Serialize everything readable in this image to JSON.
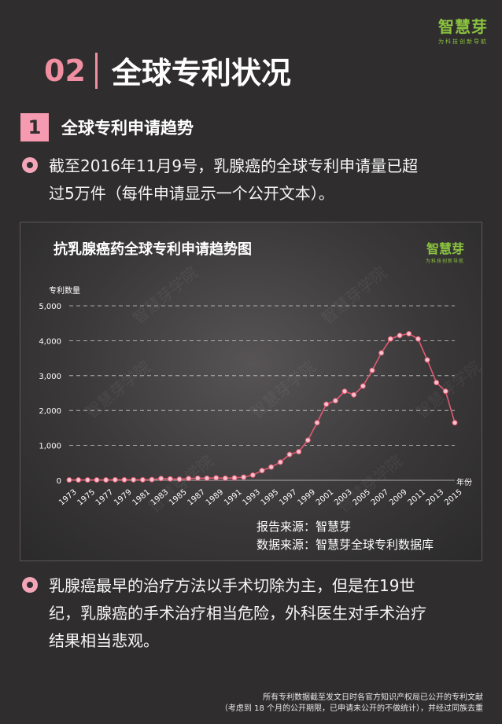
{
  "brand": {
    "name": "智慧芽",
    "sub": "为科技创新导航"
  },
  "section": {
    "num": "02",
    "title": "全球专利状况"
  },
  "sub": {
    "num": "1",
    "title": "全球专利申请趋势"
  },
  "bullet1": {
    "line1": "截至2016年11月9号，乳腺癌的全球专利申请量已超",
    "line2": "过5万件（每件申请显示一个公开文本）。"
  },
  "bullet2": {
    "line1": "乳腺癌最早的治疗方法以手术切除为主，但是在19世",
    "line2": "纪，乳腺癌的手术治疗相当危险，外科医生对手术治疗",
    "line3": "结果相当悲观。"
  },
  "chart_brand": {
    "name": "智慧芽",
    "sub": "为科技创新导航"
  },
  "watermark": "智慧芽学院",
  "sources": {
    "report": "报告来源：智慧芽",
    "data": "数据来源：智慧芽全球专利数据库"
  },
  "footer": {
    "line1": "所有专利数据截至发文日时各官方知识产权局已公开的专利文献",
    "line2": "（考虑到 18 个月的公开期限，已申请未公开的不做统计），并经过同族去重"
  },
  "chart_data": {
    "type": "line",
    "title": "抗乳腺癌药全球专利申请趋势图",
    "ylabel": "专利数量",
    "xlabel": "年份",
    "ylim": [
      0,
      5000
    ],
    "yticks": [
      0,
      1000,
      2000,
      3000,
      4000,
      5000
    ],
    "ytick_labels": [
      "0",
      "1,000",
      "2,000",
      "3,000",
      "4,000",
      "5,000"
    ],
    "xtick_labels": [
      "1973",
      "1975",
      "1977",
      "1979",
      "1981",
      "1983",
      "1985",
      "1987",
      "1989",
      "1991",
      "1993",
      "1995",
      "1997",
      "1999",
      "2001",
      "2003",
      "2005",
      "2007",
      "2009",
      "2011",
      "2013",
      "2015"
    ],
    "x": [
      1973,
      1974,
      1975,
      1976,
      1977,
      1978,
      1979,
      1980,
      1981,
      1982,
      1983,
      1984,
      1985,
      1986,
      1987,
      1988,
      1989,
      1990,
      1991,
      1992,
      1993,
      1994,
      1995,
      1996,
      1997,
      1998,
      1999,
      2000,
      2001,
      2002,
      2003,
      2004,
      2005,
      2006,
      2007,
      2008,
      2009,
      2010,
      2011,
      2012,
      2013,
      2014,
      2015
    ],
    "series": [
      {
        "values": [
          10,
          10,
          10,
          10,
          10,
          15,
          15,
          15,
          15,
          20,
          50,
          40,
          30,
          50,
          60,
          60,
          70,
          60,
          70,
          90,
          150,
          280,
          380,
          520,
          740,
          820,
          1150,
          1650,
          2180,
          2280,
          2550,
          2450,
          2700,
          3150,
          3650,
          4050,
          4150,
          4200,
          4050,
          3450,
          2800,
          2550,
          1650
        ]
      }
    ],
    "grid": true,
    "colors": {
      "line": "#e05a72",
      "point": "#f7c3cd"
    }
  }
}
